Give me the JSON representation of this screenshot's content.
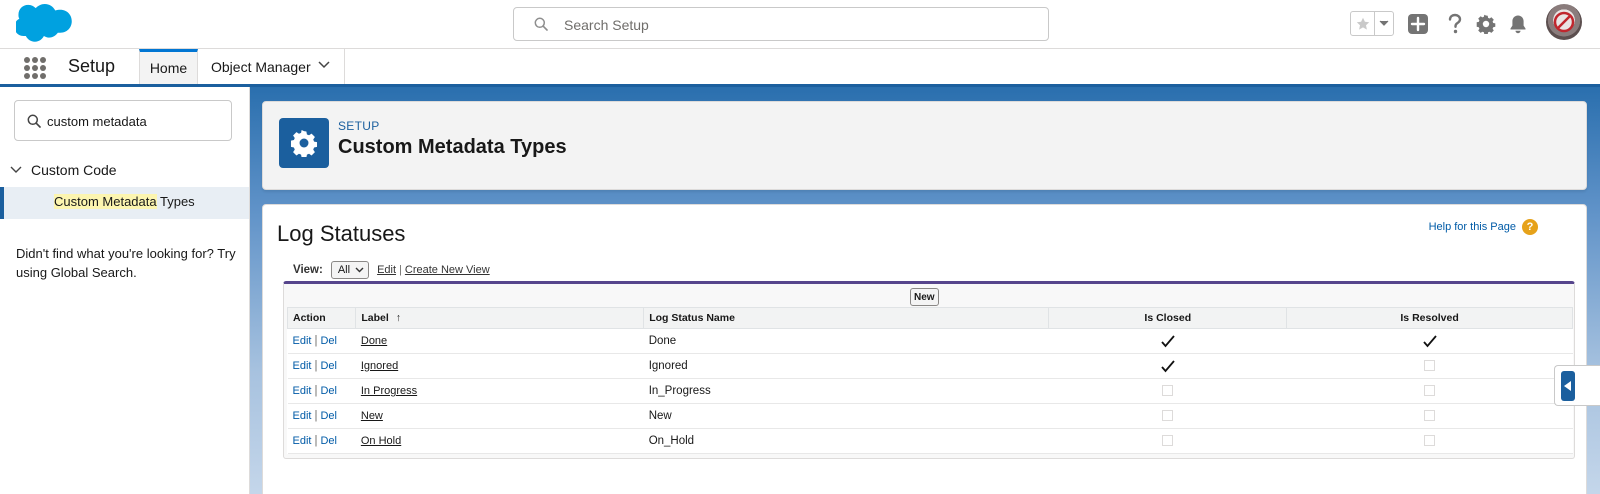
{
  "header": {
    "search_placeholder": "Search Setup",
    "logo": "salesforce-cloud-logo",
    "icons": [
      "star-icon",
      "chevron-down-icon",
      "add-icon",
      "help-icon",
      "gear-icon",
      "bell-icon"
    ]
  },
  "context_bar": {
    "app_name": "Setup",
    "tabs": [
      {
        "label": "Home",
        "active": true
      },
      {
        "label": "Object Manager",
        "active": false
      }
    ]
  },
  "sidebar": {
    "quick_find_value": "custom metadata",
    "section_label": "Custom Code",
    "item": {
      "highlight": "Custom Metadata",
      "rest": " Types"
    },
    "not_found_text": "Didn't find what you're looking for? Try using Global Search."
  },
  "page_header": {
    "kicker": "SETUP",
    "title": "Custom Metadata Types"
  },
  "content": {
    "heading": "Log Statuses",
    "help_link": "Help for this Page",
    "help_icon": "?",
    "view_label": "View:",
    "view_selected": "All",
    "edit_link": "Edit",
    "separator": "|",
    "create_view_link": "Create New View",
    "new_button": "New",
    "columns": [
      "Action",
      "Label",
      "Log Status Name",
      "Is Closed",
      "Is Resolved"
    ],
    "sort_indicator": "↑",
    "row_actions": {
      "edit": "Edit",
      "del": "Del"
    },
    "rows": [
      {
        "label": "Done",
        "name": "Done",
        "is_closed": true,
        "is_resolved": true
      },
      {
        "label": "Ignored",
        "name": "Ignored",
        "is_closed": true,
        "is_resolved": false
      },
      {
        "label": "In Progress",
        "name": "In_Progress",
        "is_closed": false,
        "is_resolved": false
      },
      {
        "label": "New",
        "name": "New",
        "is_closed": false,
        "is_resolved": false
      },
      {
        "label": "On Hold",
        "name": "On_Hold",
        "is_closed": false,
        "is_resolved": false
      }
    ]
  },
  "colors": {
    "brand_blue": "#1b5f9e",
    "link_blue": "#015ba7",
    "list_accent": "#56458c",
    "help_orange": "#e6a21a",
    "highlight_yellow": "#fcf5b0"
  }
}
